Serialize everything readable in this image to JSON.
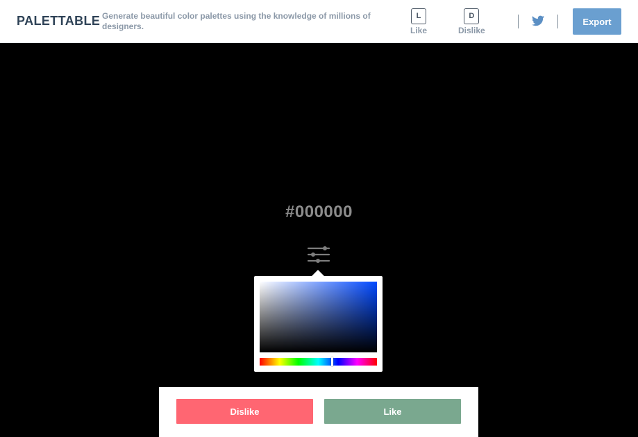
{
  "header": {
    "logo": "PALETTABLE",
    "tagline": "Generate beautiful color palettes using the knowledge of millions of designers.",
    "shortcuts": [
      {
        "key": "L",
        "label": "Like"
      },
      {
        "key": "D",
        "label": "Dislike"
      }
    ],
    "twitter_icon": "twitter-icon",
    "export_label": "Export"
  },
  "swatch": {
    "color": "#000000",
    "hex_label": "#000000",
    "settings_icon": "sliders-icon"
  },
  "picker": {
    "hue_color": "#0048ff"
  },
  "actions": {
    "dislike_label": "Dislike",
    "like_label": "Like"
  },
  "colors": {
    "accent_export": "#6a9fd0",
    "dislike": "#ff6672",
    "like": "#7aa88f",
    "logo_text": "#2f4357",
    "muted_text": "#8c99a8"
  }
}
